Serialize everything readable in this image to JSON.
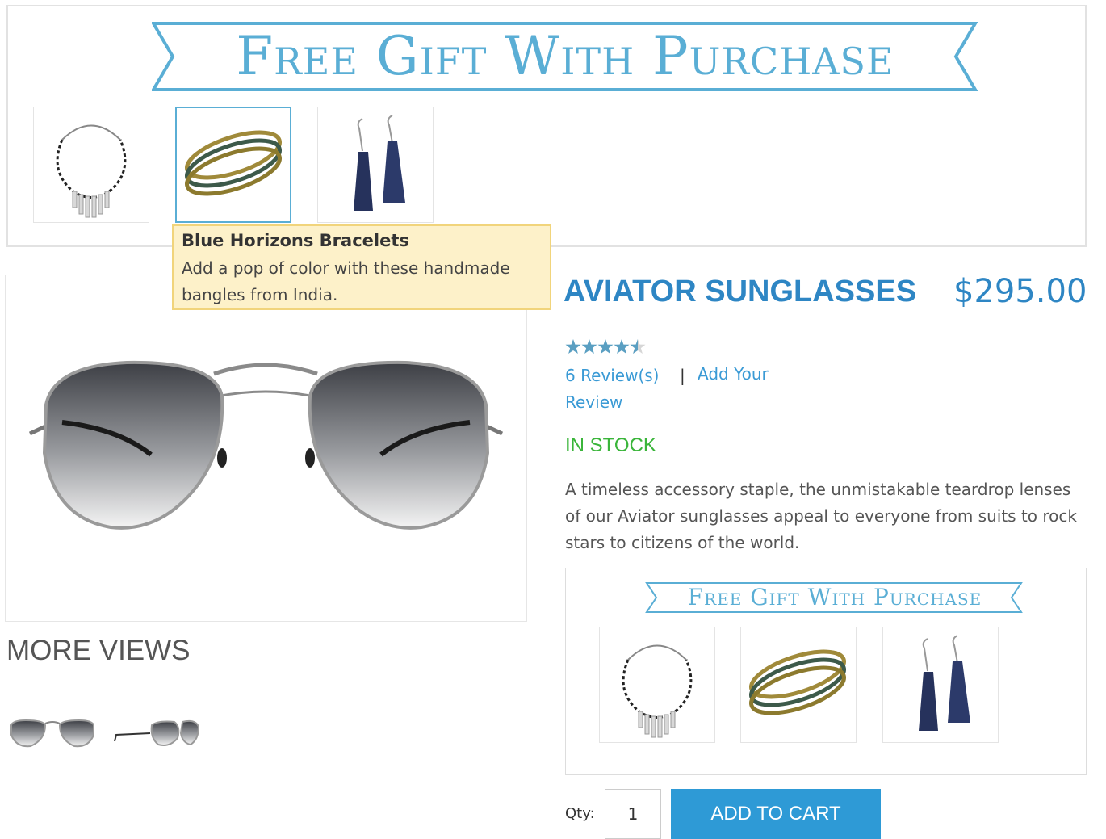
{
  "top_banner": {
    "ribbon_text": "Free Gift With Purchase",
    "gifts": [
      {
        "name": "necklace",
        "icon": "necklace-icon"
      },
      {
        "name": "bracelets",
        "icon": "bracelets-icon",
        "selected": true
      },
      {
        "name": "earrings",
        "icon": "earrings-icon"
      }
    ]
  },
  "tooltip": {
    "title": "Blue Horizons Bracelets",
    "text": "Add a pop of color with these handmade bangles from India."
  },
  "main_image": {
    "icon": "aviator-sunglasses-image"
  },
  "more_views": {
    "title": "MORE VIEWS",
    "thumbs": [
      {
        "icon": "sunglasses-front-thumb"
      },
      {
        "icon": "sunglasses-side-thumb"
      }
    ]
  },
  "product": {
    "title": "AVIATOR SUNGLASSES",
    "price": "$295.00",
    "rating": 4.5,
    "rating_max": 5,
    "reviews_label": "6 Review(s)",
    "separator": "|",
    "add_review_line1": "Add Your",
    "add_review_line2": "Review",
    "stock": "IN STOCK",
    "description": "A timeless accessory staple, the unmistakable teardrop lenses of our Aviator sunglasses appeal to everyone from suits to rock stars to citizens of the world."
  },
  "sub_banner": {
    "ribbon_text": "Free Gift With Purchase",
    "gifts": [
      {
        "name": "necklace",
        "icon": "necklace-icon"
      },
      {
        "name": "bracelets",
        "icon": "bracelets-icon"
      },
      {
        "name": "earrings",
        "icon": "earrings-icon"
      }
    ]
  },
  "cart": {
    "qty_label": "Qty:",
    "qty_value": "1",
    "add_to_cart_label": "ADD TO CART"
  },
  "colors": {
    "accent": "#2e86c4",
    "ribbon": "#5aaed5",
    "stock": "#3ab53a",
    "tooltip_bg": "#fdf1c9",
    "button": "#2e9ad6"
  }
}
